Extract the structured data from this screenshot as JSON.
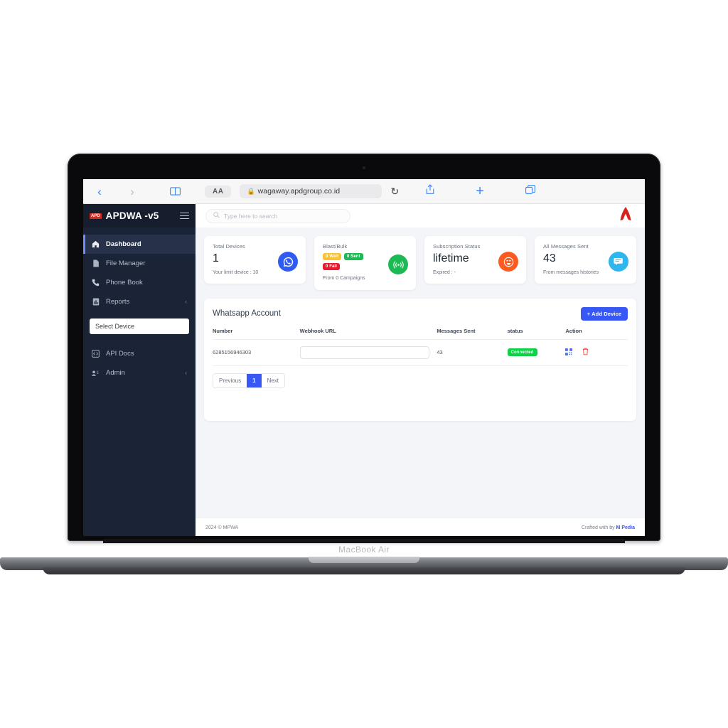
{
  "device": {
    "model_label": "MacBook Air"
  },
  "browser": {
    "back_icon": "chevron-left-icon",
    "forward_icon": "chevron-right-icon",
    "reader_icon": "book-icon",
    "text_size_label": "AA",
    "lock_icon": "lock-icon",
    "url": "wagaway.apdgroup.co.id",
    "reload_icon": "reload-icon",
    "share_icon": "share-icon",
    "new_tab_icon": "plus-icon",
    "tabs_icon": "tabs-icon"
  },
  "sidebar": {
    "brand_logo_text": "APD",
    "brand_title": "APDWA -v5",
    "menu_icon": "hamburger-icon",
    "items": [
      {
        "label": "Dashboard",
        "icon": "home-icon",
        "selected": true,
        "chevron": false
      },
      {
        "label": "File Manager",
        "icon": "file-icon",
        "selected": false,
        "chevron": false
      },
      {
        "label": "Phone Book",
        "icon": "phone-icon",
        "selected": false,
        "chevron": false
      },
      {
        "label": "Reports",
        "icon": "chart-icon",
        "selected": false,
        "chevron": true
      }
    ],
    "select_device_label": "Select Device",
    "items_lower": [
      {
        "label": "API Docs",
        "icon": "code-icon",
        "chevron": false
      },
      {
        "label": "Admin",
        "icon": "users-icon",
        "chevron": true
      }
    ],
    "chevron_glyph": "‹"
  },
  "topbar": {
    "search_placeholder": "Type here to search",
    "search_icon": "search-icon",
    "logo_icon": "apd-logo-icon",
    "logo_color": "#d8231c"
  },
  "cards": [
    {
      "title": "Total Devices",
      "value": "1",
      "sub": "Your limit device : 10",
      "icon": "whatsapp-icon",
      "icon_color": "#2f5bf0"
    },
    {
      "title": "Blast/Bulk",
      "value": "",
      "sub": "From 0 Campaigns",
      "icon": "broadcast-icon",
      "icon_color": "#1db954",
      "badges": [
        {
          "label": "0 Wait",
          "color": "#f9c22e"
        },
        {
          "label": "0 Sent",
          "color": "#1db954"
        },
        {
          "label": "0 Fail",
          "color": "#e8192c"
        }
      ]
    },
    {
      "title": "Subscription Status",
      "value": "lifetime",
      "sub": "Expired : -",
      "icon": "smile-icon",
      "icon_color": "#fb5b21"
    },
    {
      "title": "All Messages Sent",
      "value": "43",
      "sub": "From messages histories",
      "icon": "chat-icon",
      "icon_color": "#2fb6ef"
    }
  ],
  "panel": {
    "title": "Whatsapp Account",
    "add_button": "+ Add Device",
    "columns": [
      "Number",
      "Webhook URL",
      "Messages Sent",
      "status",
      "Action"
    ],
    "rows": [
      {
        "number": "6285156946303",
        "webhook_url": "",
        "webhook_placeholder": "",
        "messages_sent": "43",
        "status": "Connected",
        "status_color": "#0ed145",
        "actions": [
          "qr-code-icon",
          "trash-icon"
        ]
      }
    ],
    "pagination": {
      "previous": "Previous",
      "current": "1",
      "next": "Next"
    }
  },
  "footer": {
    "left": "2024 © MPWA",
    "right_prefix": "Crafted with by ",
    "right_link": "M Pedia"
  }
}
